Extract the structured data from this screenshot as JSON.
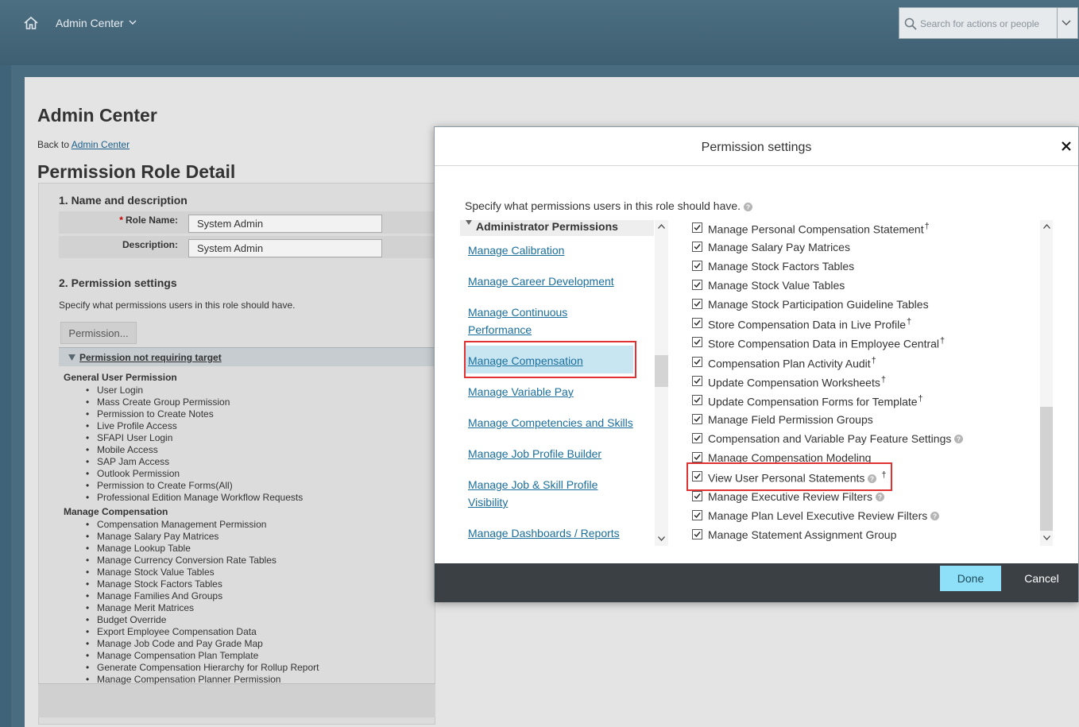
{
  "shell": {
    "title": "Admin Center",
    "home_icon": "home-icon",
    "search_placeholder": "Search for actions or people"
  },
  "page": {
    "title": "Admin Center",
    "back_prefix": "Back to",
    "back_link": "Admin Center",
    "role_title": "Permission Role Detail",
    "section1": "1. Name and description",
    "role_name_label": "Role Name:",
    "role_name_value": "System Admin",
    "description_label": "Description:",
    "description_value": "System Admin",
    "section2": "2. Permission settings",
    "section2_desc": "Specify what permissions users in this role should have.",
    "permission_button": "Permission...",
    "target_bar": "Permission not requiring target",
    "groups": [
      {
        "title": "General User Permission",
        "items": [
          "User Login",
          "Mass Create Group Permission",
          "Permission to Create Notes",
          "Live Profile Access",
          "SFAPI User Login",
          "Mobile Access",
          "SAP Jam Access",
          "Outlook Permission",
          "Permission to Create Forms(All)",
          "Professional Edition Manage Workflow Requests"
        ]
      },
      {
        "title": "Manage Compensation",
        "items": [
          "Compensation Management Permission",
          "Manage Salary Pay Matrices",
          "Manage Lookup Table",
          "Manage Currency Conversion Rate Tables",
          "Manage Stock Value Tables",
          "Manage Stock Factors Tables",
          "Manage Families And Groups",
          "Manage Merit Matrices",
          "Budget Override",
          "Export Employee Compensation Data",
          "Manage Job Code and Pay Grade Map",
          "Manage Compensation Plan Template",
          "Generate Compensation Hierarchy for Rollup Report",
          "Manage Compensation Planner Permission"
        ]
      }
    ]
  },
  "modal": {
    "title": "Permission settings",
    "description": "Specify what permissions users in this role should have.",
    "category_header": "Administrator Permissions",
    "categories": [
      "Manage Calibration",
      "Manage Career Development",
      "Manage Continuous",
      "Performance",
      "Manage Compensation",
      "Manage Variable Pay",
      "Manage Competencies and Skills",
      "Manage Job Profile Builder",
      "Manage Job & Skill Profile",
      "Visibility",
      "Manage Dashboards / Reports"
    ],
    "permissions": [
      "Manage Personal Compensation Statement",
      "Manage Salary Pay Matrices",
      "Manage Stock Factors Tables",
      "Manage Stock Value Tables",
      "Manage Stock Participation Guideline Tables",
      "Store Compensation Data in Live Profile",
      "Store Compensation Data in Employee Central",
      "Compensation Plan Activity Audit",
      "Update Compensation Worksheets",
      "Update Compensation Forms for Template",
      "Manage Field Permission Groups",
      "Compensation and Variable Pay Feature Settings",
      "Manage Compensation Modeling",
      "View User Personal Statements",
      "Manage Executive Review Filters",
      "Manage Plan Level Executive Review Filters",
      "Manage Statement Assignment Group"
    ],
    "dagger": "†",
    "done": "Done",
    "cancel": "Cancel"
  },
  "colors": {
    "highlight": "#e03232",
    "link": "#1a6e9c",
    "selected_bg": "#c8e6f2",
    "done_bg": "#8de0f7",
    "footer_bg": "#3a4043"
  }
}
